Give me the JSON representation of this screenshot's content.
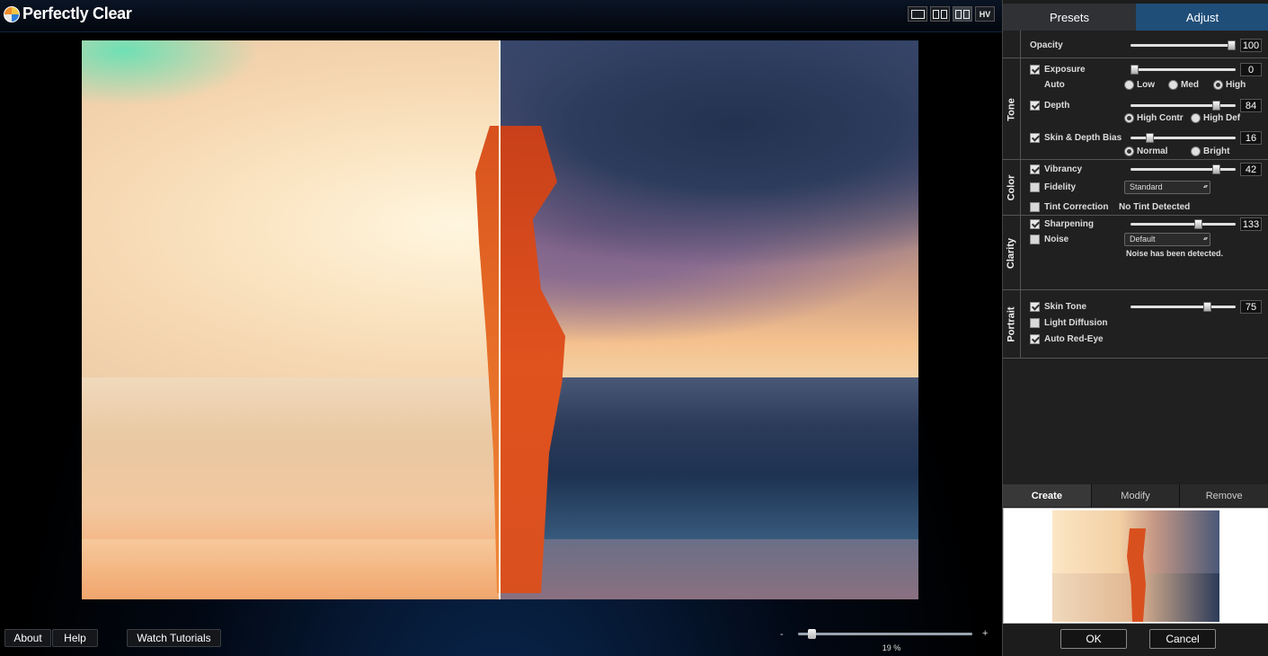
{
  "app": {
    "title": "Perfectly Clear"
  },
  "view_modes": {
    "single": "",
    "split": "",
    "side": "",
    "hv": "HV"
  },
  "tabs": {
    "presets": "Presets",
    "adjust": "Adjust"
  },
  "opacity": {
    "label": "Opacity",
    "value": "100",
    "level": 100,
    "max": 100
  },
  "tone": {
    "title": "Tone",
    "exposure": {
      "label": "Exposure",
      "value": "0",
      "level": 0,
      "max": 100
    },
    "auto": {
      "label": "Auto",
      "low": "Low",
      "med": "Med",
      "high": "High"
    },
    "depth": {
      "label": "Depth",
      "value": "84",
      "level": 84,
      "max": 100
    },
    "depth_mode": {
      "high_contr": "High Contr",
      "high_def": "High Def"
    },
    "skin_depth": {
      "label": "Skin & Depth Bias",
      "value": "16",
      "level": 16,
      "max": 100
    },
    "skin_mode": {
      "normal": "Normal",
      "bright": "Bright"
    }
  },
  "color": {
    "title": "Color",
    "vibrancy": {
      "label": "Vibrancy",
      "value": "42",
      "level": 84,
      "max": 100
    },
    "fidelity": {
      "label": "Fidelity",
      "select": "Standard"
    },
    "tint": {
      "label": "Tint Correction",
      "status": "No Tint Detected"
    }
  },
  "clarity": {
    "title": "Clarity",
    "sharpening": {
      "label": "Sharpening",
      "value": "133",
      "level": 66,
      "max": 100
    },
    "noise": {
      "label": "Noise",
      "select": "Default",
      "status": "Noise has been detected."
    }
  },
  "portrait": {
    "title": "Portrait",
    "skin_tone": {
      "label": "Skin Tone",
      "value": "75",
      "level": 75,
      "max": 100
    },
    "light_diffusion": {
      "label": "Light Diffusion"
    },
    "red_eye": {
      "label": "Auto Red-Eye"
    }
  },
  "actions": {
    "create": "Create",
    "modify": "Modify",
    "remove": "Remove"
  },
  "footer": {
    "about": "About",
    "help": "Help",
    "tutorials": "Watch Tutorials",
    "zoom_minus": "-",
    "zoom_plus": "+",
    "zoom_value": "19 %",
    "zoom_level": 0.06,
    "ok": "OK",
    "cancel": "Cancel"
  },
  "colors": {
    "accent": "#1f4e78",
    "panel": "#202020"
  },
  "icons": {
    "logo": "perfectly-clear-logo-icon"
  }
}
